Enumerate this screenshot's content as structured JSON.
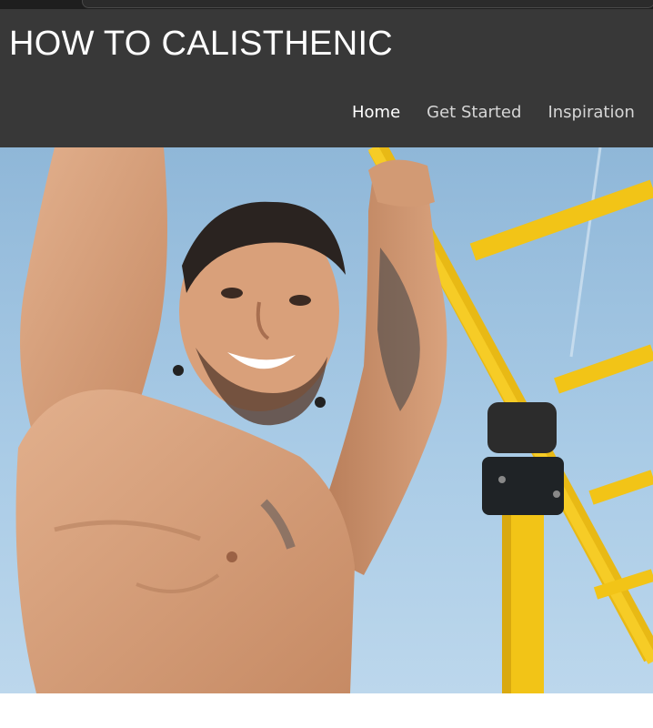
{
  "site": {
    "title": "HOW TO CALISTHENIC"
  },
  "nav": {
    "items": [
      {
        "label": "Home",
        "active": true
      },
      {
        "label": "Get Started",
        "active": false
      },
      {
        "label": "Inspiration",
        "active": false
      }
    ]
  },
  "hero": {
    "image": "man-hanging-on-yellow-pull-up-bar-photo"
  },
  "colors": {
    "header_bg": "#383838",
    "title_text": "#ffffff",
    "nav_text": "#d6d6d6",
    "bar_yellow": "#f2c417",
    "sky": "#a9cbe6"
  }
}
